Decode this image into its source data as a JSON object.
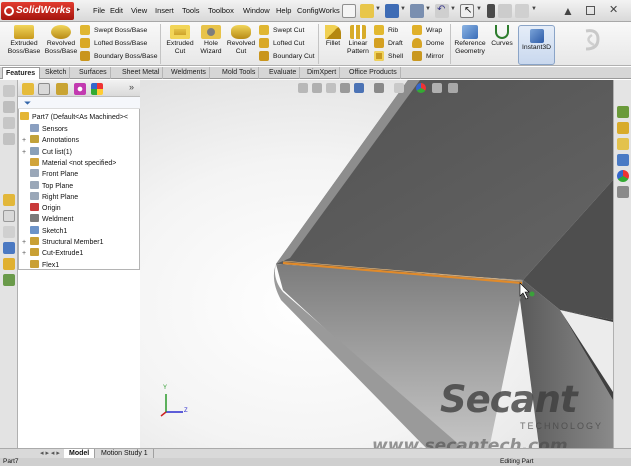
{
  "app": {
    "name": "SolidWorks"
  },
  "menu": [
    "File",
    "Edit",
    "View",
    "Insert",
    "Tools",
    "Toolbox",
    "Window",
    "Help",
    "ConfigWorks"
  ],
  "command_manager": {
    "extruded_boss": "Extruded Boss/Base",
    "revolved_boss": "Revolved Boss/Base",
    "swept_boss": "Swept Boss/Base",
    "lofted_boss": "Lofted Boss/Base",
    "boundary_boss": "Boundary Boss/Base",
    "extruded_cut": "Extruded Cut",
    "hole_wizard": "Hole Wizard",
    "revolved_cut": "Revolved Cut",
    "swept_cut": "Swept Cut",
    "lofted_cut": "Lofted Cut",
    "boundary_cut": "Boundary Cut",
    "fillet": "Fillet",
    "linear_pattern": "Linear Pattern",
    "rib": "Rib",
    "draft": "Draft",
    "shell": "Shell",
    "wrap": "Wrap",
    "dome": "Dome",
    "mirror": "Mirror",
    "reference_geometry": "Reference Geometry",
    "curves": "Curves",
    "instant3d": "Instant3D"
  },
  "tabs": [
    "Features",
    "Sketch",
    "Surfaces",
    "Sheet Metal",
    "Weldments",
    "Mold Tools",
    "Evaluate",
    "DimXpert",
    "Office Products"
  ],
  "tree": {
    "root": "Part7  (Default<As Machined><",
    "items": [
      {
        "label": "Sensors",
        "exp": ""
      },
      {
        "label": "Annotations",
        "exp": "+"
      },
      {
        "label": "Cut list(1)",
        "exp": "+"
      },
      {
        "label": "Material <not specified>",
        "exp": ""
      },
      {
        "label": "Front Plane",
        "exp": ""
      },
      {
        "label": "Top Plane",
        "exp": ""
      },
      {
        "label": "Right Plane",
        "exp": ""
      },
      {
        "label": "Origin",
        "exp": ""
      },
      {
        "label": "Weldment",
        "exp": ""
      },
      {
        "label": "Sketch1",
        "exp": ""
      },
      {
        "label": "Structural Member1",
        "exp": "+"
      },
      {
        "label": "Cut-Extrude1",
        "exp": "+"
      },
      {
        "label": "Flex1",
        "exp": ""
      }
    ]
  },
  "axis_labels": {
    "y": "Y",
    "z": "Z"
  },
  "bottom_tabs": [
    "Model",
    "Motion Study 1"
  ],
  "status": {
    "left": "Part7",
    "right": "Editing Part"
  },
  "watermark": {
    "main": "Secant",
    "sub": "TECHNOLOGY",
    "url": "www.secantech.com"
  },
  "colors": {
    "selected_edge": "#e08a2a",
    "frame_body": "#6e6e6e",
    "frame_top": "#5a5a5a"
  }
}
